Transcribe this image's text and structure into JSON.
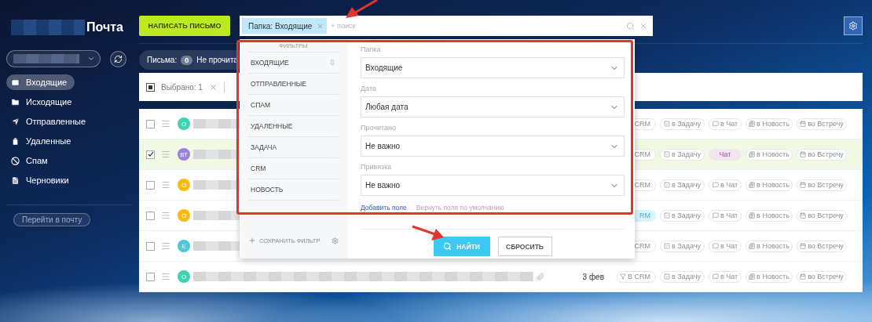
{
  "sidebar": {
    "title": "Почта",
    "nav": [
      {
        "label": "Входящие",
        "selected": true
      },
      {
        "label": "Исходящие",
        "selected": false
      },
      {
        "label": "Отправленные",
        "selected": false
      },
      {
        "label": "Удаленные",
        "selected": false
      },
      {
        "label": "Спам",
        "selected": false
      },
      {
        "label": "Черновики",
        "selected": false
      }
    ],
    "goto_button": "Перейти в почту"
  },
  "toolbar": {
    "compose_button": "НАПИСАТЬ ПИСЬМО",
    "search": {
      "chip": "Папка: Входящие",
      "placeholder": "+ поиск"
    }
  },
  "counter": {
    "label": "Письма:",
    "count": "0",
    "text": "Не прочита"
  },
  "selection": {
    "label": "Выбрано: 1",
    "partial": true
  },
  "messages": [
    {
      "checked": false,
      "avatar": "О",
      "color": "#3fd3b6",
      "actions": [
        {
          "kind": "crm",
          "label": "CRM",
          "icon": false,
          "selected": false
        },
        {
          "kind": "task",
          "label": "в Задачу",
          "selected": false
        },
        {
          "kind": "chat",
          "label": "в Чат",
          "selected": false
        },
        {
          "kind": "news",
          "label": "в Новость",
          "selected": false
        },
        {
          "kind": "meeting",
          "label": "во Встречу",
          "selected": false
        }
      ]
    },
    {
      "checked": true,
      "avatar": "ВТ",
      "color": "#9c7fe0",
      "actions": [
        {
          "kind": "crm",
          "label": "CRM",
          "icon": false,
          "selected": false
        },
        {
          "kind": "task",
          "label": "в Задачу",
          "selected": false
        },
        {
          "kind": "chat",
          "label": "Чат",
          "selected": true
        },
        {
          "kind": "news",
          "label": "в Новость",
          "selected": false
        },
        {
          "kind": "meeting",
          "label": "во Встречу",
          "selected": false
        }
      ]
    },
    {
      "checked": false,
      "avatar": "О",
      "color": "#fdb913",
      "actions": [
        {
          "kind": "crm",
          "label": "CRM",
          "icon": false,
          "selected": false
        },
        {
          "kind": "task",
          "label": "в Задачу",
          "selected": false
        },
        {
          "kind": "chat",
          "label": "в Чат",
          "selected": false
        },
        {
          "kind": "news",
          "label": "в Новость",
          "selected": false
        },
        {
          "kind": "meeting",
          "label": "во Встречу",
          "selected": false
        }
      ]
    },
    {
      "checked": false,
      "avatar": "О",
      "color": "#fdb913",
      "actions": [
        {
          "kind": "crm",
          "label": "RM",
          "icon": false,
          "selected": true
        },
        {
          "kind": "task",
          "label": "в Задачу",
          "selected": false
        },
        {
          "kind": "chat",
          "label": "в Чат",
          "selected": false
        },
        {
          "kind": "news",
          "label": "в Новость",
          "selected": false
        },
        {
          "kind": "meeting",
          "label": "во Встречу",
          "selected": false
        }
      ]
    },
    {
      "checked": false,
      "avatar": "Е",
      "color": "#48c9de",
      "actions": [
        {
          "kind": "crm",
          "label": "CRM",
          "icon": false,
          "selected": false
        },
        {
          "kind": "task",
          "label": "в Задачу",
          "selected": false
        },
        {
          "kind": "chat",
          "label": "в Чат",
          "selected": false
        },
        {
          "kind": "news",
          "label": "в Новость",
          "selected": false
        },
        {
          "kind": "meeting",
          "label": "во Встречу",
          "selected": false
        }
      ]
    },
    {
      "checked": false,
      "avatar": "О",
      "color": "#3fd3b6",
      "attachment": true,
      "date": "3 фев",
      "actions": [
        {
          "kind": "crm",
          "label": "В CRM",
          "icon": true,
          "selected": false
        },
        {
          "kind": "task",
          "label": "в Задачу",
          "selected": false
        },
        {
          "kind": "chat",
          "label": "в Чат",
          "selected": false
        },
        {
          "kind": "news",
          "label": "в Новость",
          "selected": false
        },
        {
          "kind": "meeting",
          "label": "во Встречу",
          "selected": false
        }
      ]
    }
  ],
  "filter_panel": {
    "title": "ФИЛЬТРЫ",
    "presets": [
      {
        "label": "ВХОДЯЩИЕ",
        "pinned": true
      },
      {
        "label": "ОТПРАВЛЕННЫЕ",
        "pinned": false
      },
      {
        "label": "СПАМ",
        "pinned": false
      },
      {
        "label": "УДАЛЕННЫЕ",
        "pinned": false
      },
      {
        "label": "ЗАДАЧА",
        "pinned": false
      },
      {
        "label": "CRM",
        "pinned": false
      },
      {
        "label": "НОВОСТЬ",
        "pinned": false
      }
    ],
    "save_filter": "СОХРАНИТЬ ФИЛЬТР",
    "fields": [
      {
        "label": "Папка",
        "value": "Входящие"
      },
      {
        "label": "Дата",
        "value": "Любая дата"
      },
      {
        "label": "Прочитано",
        "value": "Не важно"
      },
      {
        "label": "Привязка",
        "value": "Не важно"
      }
    ],
    "add_field": "Добавить поле",
    "reset_fields": "Вернуть поля по умолчанию",
    "find_button": "НАЙТИ",
    "reset_button": "СБРОСИТЬ"
  }
}
